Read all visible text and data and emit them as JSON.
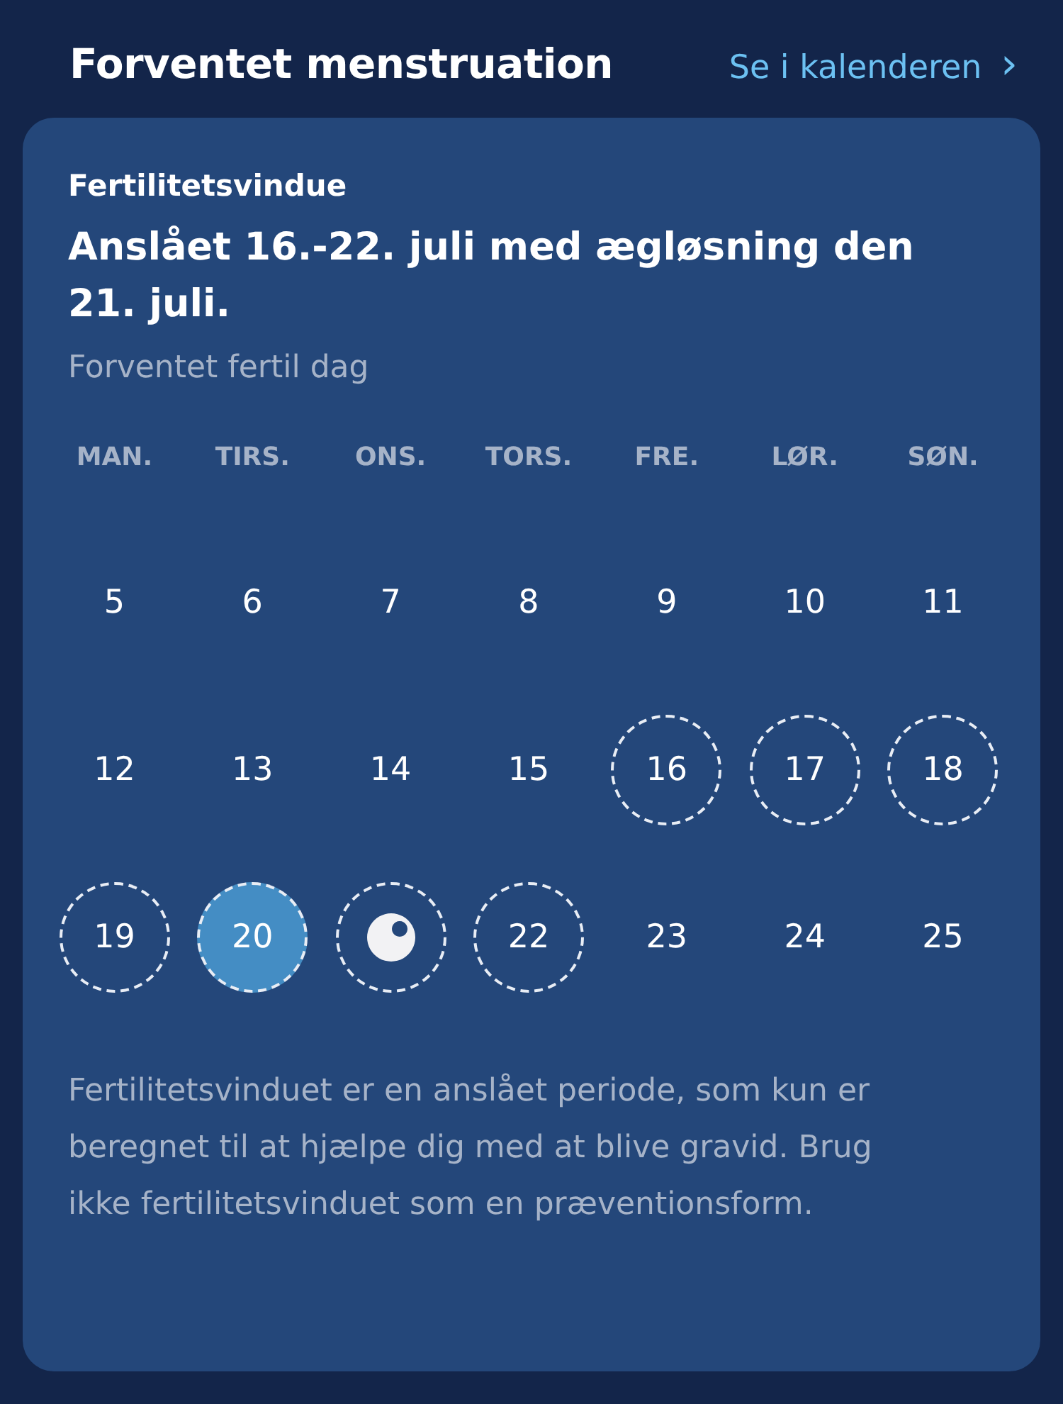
{
  "header": {
    "title": "Forventet menstruation",
    "link": "Se i kalenderen",
    "chevron": "›"
  },
  "card": {
    "label": "Fertilitetsvindue",
    "headline": "Anslået 16.-22. juli med ægløsning den 21. juli.",
    "legend": "Forventet fertil dag",
    "weekdays": [
      "MAN.",
      "TIRS.",
      "ONS.",
      "TORS.",
      "FRE.",
      "LØR.",
      "SØN."
    ],
    "days": [
      {
        "kind": "date",
        "label": "5",
        "fertile": false,
        "highlighted": false
      },
      {
        "kind": "date",
        "label": "6",
        "fertile": false,
        "highlighted": false
      },
      {
        "kind": "date",
        "label": "7",
        "fertile": false,
        "highlighted": false
      },
      {
        "kind": "date",
        "label": "8",
        "fertile": false,
        "highlighted": false
      },
      {
        "kind": "date",
        "label": "9",
        "fertile": false,
        "highlighted": false
      },
      {
        "kind": "date",
        "label": "10",
        "fertile": false,
        "highlighted": false
      },
      {
        "kind": "date",
        "label": "11",
        "fertile": false,
        "highlighted": false
      },
      {
        "kind": "date",
        "label": "12",
        "fertile": false,
        "highlighted": false
      },
      {
        "kind": "date",
        "label": "13",
        "fertile": false,
        "highlighted": false
      },
      {
        "kind": "date",
        "label": "14",
        "fertile": false,
        "highlighted": false
      },
      {
        "kind": "date",
        "label": "15",
        "fertile": false,
        "highlighted": false
      },
      {
        "kind": "date",
        "label": "16",
        "fertile": true,
        "highlighted": false
      },
      {
        "kind": "date",
        "label": "17",
        "fertile": true,
        "highlighted": false
      },
      {
        "kind": "date",
        "label": "18",
        "fertile": true,
        "highlighted": false
      },
      {
        "kind": "date",
        "label": "19",
        "fertile": true,
        "highlighted": false
      },
      {
        "kind": "date",
        "label": "20",
        "fertile": true,
        "highlighted": true
      },
      {
        "kind": "ovulation",
        "fertile": true,
        "highlighted": false
      },
      {
        "kind": "date",
        "label": "22",
        "fertile": true,
        "highlighted": false
      },
      {
        "kind": "date",
        "label": "23",
        "fertile": false,
        "highlighted": false
      },
      {
        "kind": "date",
        "label": "24",
        "fertile": false,
        "highlighted": false
      },
      {
        "kind": "date",
        "label": "25",
        "fertile": false,
        "highlighted": false
      }
    ],
    "disclaimer": "Fertilitetsvinduet er en anslået periode, som kun er beregnet til at hjælpe dig med at blive gravid. Brug ikke fertilitetsvinduet som en præventionsform."
  }
}
